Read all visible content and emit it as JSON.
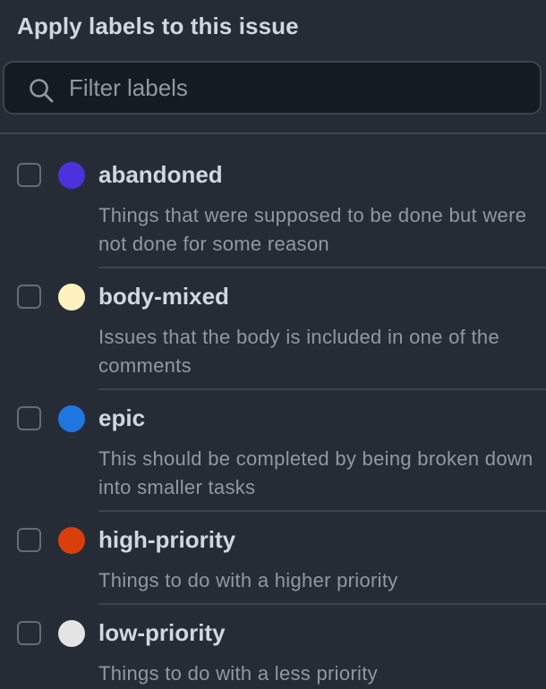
{
  "header": {
    "title": "Apply labels to this issue"
  },
  "search": {
    "placeholder": "Filter labels",
    "value": "",
    "icon": "search-icon"
  },
  "labels": [
    {
      "name": "abandoned",
      "description": "Things that were supposed to be done but were not done for some reason",
      "color": "#4b32dc",
      "checked": false
    },
    {
      "name": "body-mixed",
      "description": "Issues that the body is included in one of the comments",
      "color": "#fef2c0",
      "checked": false
    },
    {
      "name": "epic",
      "description": "This should be completed by being broken down into smaller tasks",
      "color": "#1f76e0",
      "checked": false
    },
    {
      "name": "high-priority",
      "description": "Things to do with a higher priority",
      "color": "#d93f0b",
      "checked": false
    },
    {
      "name": "low-priority",
      "description": "Things to do with a less priority",
      "color": "#e4e4e4",
      "checked": false
    }
  ]
}
